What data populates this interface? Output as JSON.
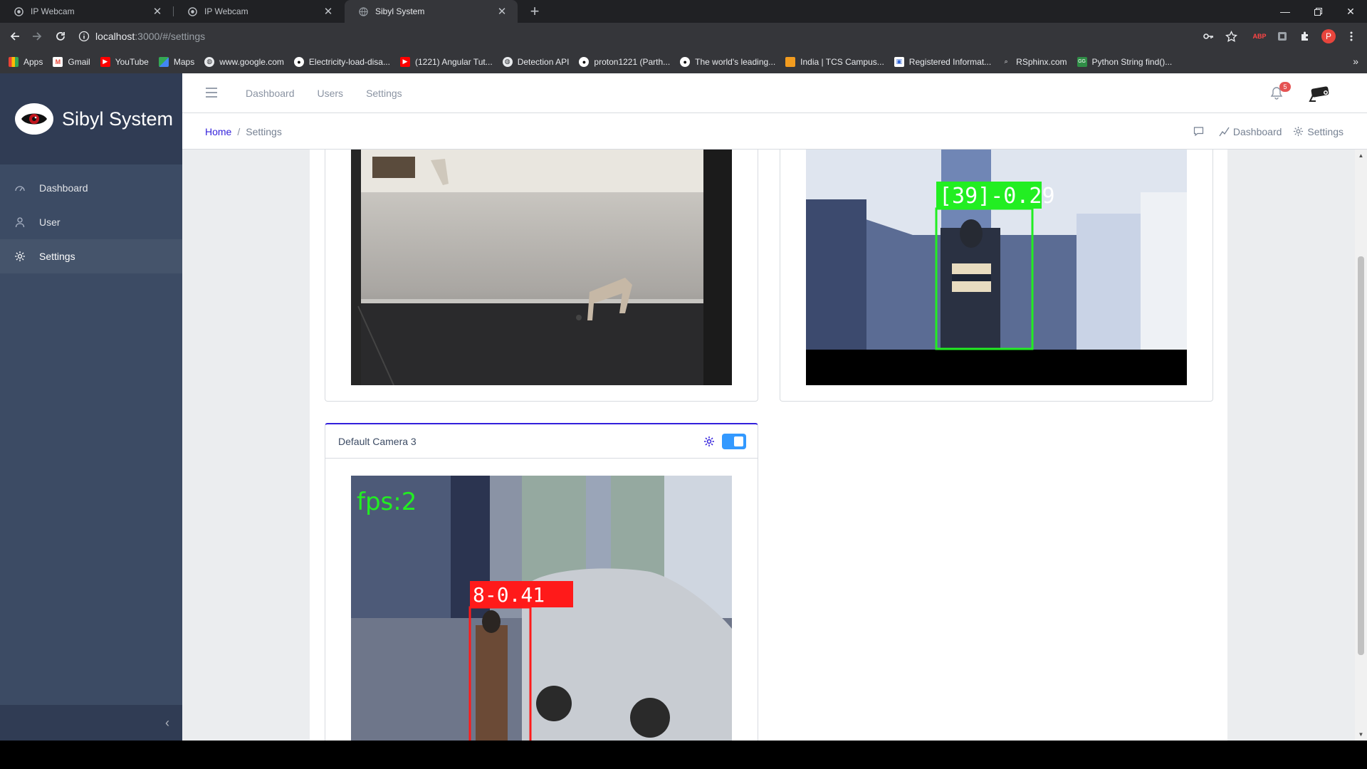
{
  "browser": {
    "tabs": [
      {
        "title": "IP Webcam"
      },
      {
        "title": "IP Webcam"
      },
      {
        "title": "Sibyl System"
      }
    ],
    "url_host": "localhost",
    "url_path": ":3000/#/settings",
    "bookmarks": [
      {
        "label": "Apps",
        "icon": "apps-grid-icon"
      },
      {
        "label": "Gmail",
        "icon": "gmail-icon"
      },
      {
        "label": "YouTube",
        "icon": "youtube-icon"
      },
      {
        "label": "Maps",
        "icon": "maps-icon"
      },
      {
        "label": "www.google.com",
        "icon": "globe-icon"
      },
      {
        "label": "Electricity-load-disa...",
        "icon": "github-icon"
      },
      {
        "label": "(1221) Angular Tut...",
        "icon": "youtube-icon"
      },
      {
        "label": "Detection API",
        "icon": "globe-icon"
      },
      {
        "label": "proton1221 (Parth...",
        "icon": "github-icon"
      },
      {
        "label": "The world's leading...",
        "icon": "github-icon"
      },
      {
        "label": "India | TCS Campus...",
        "icon": "tcs-icon"
      },
      {
        "label": "Registered Informat...",
        "icon": "page-icon"
      },
      {
        "label": "RSphinx.com",
        "icon": "search-icon"
      },
      {
        "label": "Python String find()...",
        "icon": "gfg-icon"
      }
    ],
    "extension_badge": "ABP",
    "profile_initial": "P"
  },
  "sidebar": {
    "brand": "Sibyl System",
    "items": [
      {
        "label": "Dashboard",
        "icon": "speedometer-icon"
      },
      {
        "label": "User",
        "icon": "user-icon"
      },
      {
        "label": "Settings",
        "icon": "settings-icon"
      }
    ]
  },
  "header": {
    "nav": [
      "Dashboard",
      "Users",
      "Settings"
    ],
    "notification_count": "5"
  },
  "subheader": {
    "breadcrumb_home": "Home",
    "breadcrumb_current": "Settings",
    "actions": {
      "dashboard": "Dashboard",
      "settings": "Settings"
    }
  },
  "cameras": {
    "card3_title": "Default Camera 3",
    "cam2_overlay": "[39]-0.29",
    "cam3_fps": "fps:2",
    "cam3_overlay": "8-0.41"
  },
  "colors": {
    "sidebar": "#3c4b64",
    "primary": "#321fdb",
    "detection_green": "#22ee22",
    "detection_red": "#ff1a1a"
  }
}
